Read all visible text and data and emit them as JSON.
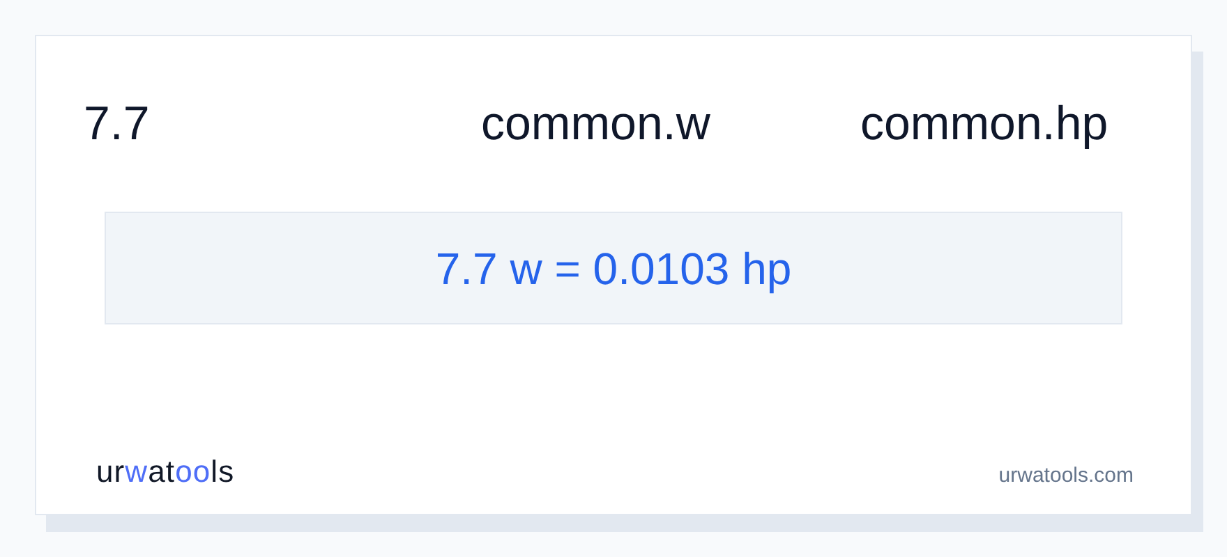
{
  "header": {
    "value": "7.7",
    "from_unit": "common.w",
    "to_unit": "common.hp"
  },
  "result": "7.7 w = 0.0103 hp",
  "footer": {
    "logo": [
      {
        "text": "ur",
        "accent": false
      },
      {
        "text": "w",
        "accent": true
      },
      {
        "text": "at",
        "accent": false
      },
      {
        "text": "oo",
        "accent": true
      },
      {
        "text": "ls",
        "accent": false
      }
    ],
    "site": "urwatools.com"
  }
}
